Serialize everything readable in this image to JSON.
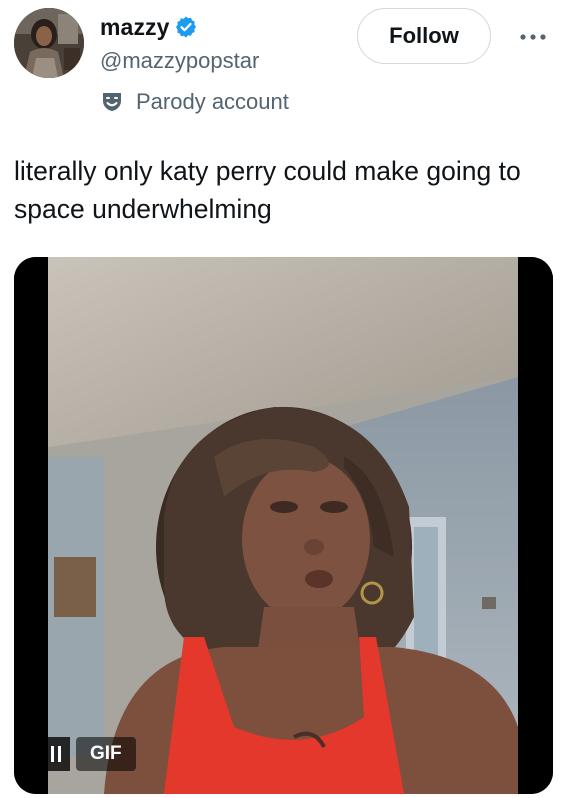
{
  "author": {
    "display_name": "mazzy",
    "handle": "@mazzypopstar",
    "verified": true,
    "parody_label": "Parody account"
  },
  "actions": {
    "follow_label": "Follow",
    "more_icon": "more-horizontal-icon"
  },
  "tweet": {
    "text": "literally only katy perry could make going to space underwhelming"
  },
  "media": {
    "type": "gif",
    "badge_label": "GIF",
    "playback_icon": "pause-icon"
  },
  "colors": {
    "verified_blue": "#1d9bf0",
    "secondary_text": "#536471",
    "border": "#cfd9de"
  }
}
